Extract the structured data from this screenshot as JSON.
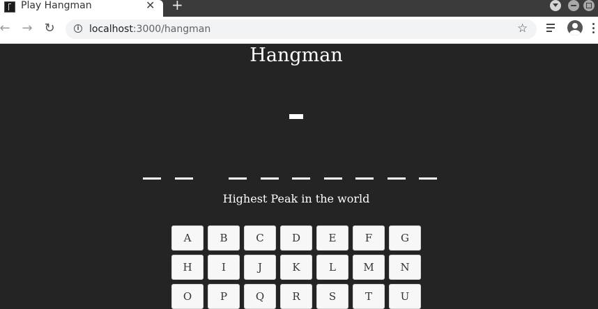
{
  "browser": {
    "tab_title": "Play Hangman",
    "tab_close": "✕",
    "new_tab": "+",
    "url_host": "localhost",
    "url_path": ":3000/hangman"
  },
  "page": {
    "title": "Hangman",
    "hint": "Highest Peak in the world",
    "blanks": [
      {
        "word": 1,
        "char": "_"
      },
      {
        "word": 1,
        "char": "_"
      },
      {
        "word": 2,
        "char": "_"
      },
      {
        "word": 2,
        "char": "_"
      },
      {
        "word": 2,
        "char": "_"
      },
      {
        "word": 2,
        "char": "_"
      },
      {
        "word": 2,
        "char": "_"
      },
      {
        "word": 2,
        "char": "_"
      },
      {
        "word": 2,
        "char": "_"
      }
    ],
    "keys": [
      "A",
      "B",
      "C",
      "D",
      "E",
      "F",
      "G",
      "H",
      "I",
      "J",
      "K",
      "L",
      "M",
      "N",
      "O",
      "P",
      "Q",
      "R",
      "S",
      "T",
      "U"
    ]
  },
  "colors": {
    "page_background": "#242424",
    "text": "#ffffff",
    "key_background": "#f7f7f7"
  }
}
